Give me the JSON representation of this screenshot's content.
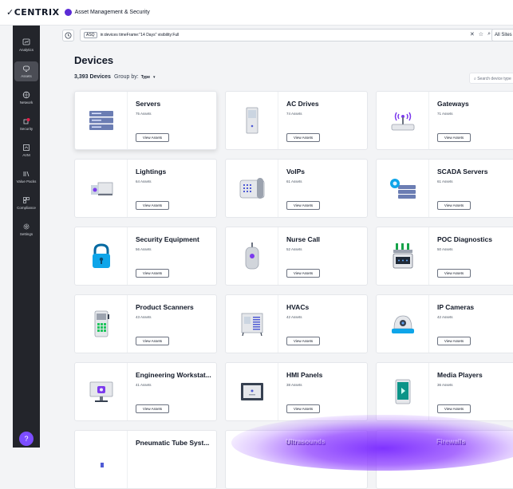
{
  "app": {
    "brand": "CENTRIX",
    "title": "Asset Management & Security"
  },
  "sidebar": {
    "items": [
      {
        "label": "Analytics",
        "icon": "analytics-icon"
      },
      {
        "label": "Assets",
        "icon": "assets-icon",
        "active": true
      },
      {
        "label": "Network",
        "icon": "network-icon"
      },
      {
        "label": "Security",
        "icon": "security-icon"
      },
      {
        "label": "AVM",
        "icon": "avm-icon"
      },
      {
        "label": "Value Packs",
        "icon": "value-packs-icon"
      },
      {
        "label": "Compliance",
        "icon": "compliance-icon"
      },
      {
        "label": "Settings",
        "icon": "settings-icon"
      }
    ],
    "help_icon": "help-icon"
  },
  "query": {
    "badge": "ASQ",
    "text": "in:devices timeFrame:\"14 Days\" visibility:Full",
    "sites": "All Sites"
  },
  "main": {
    "title": "Devices",
    "count": "3,393 Devices",
    "group_by_label": "Group by:",
    "group_by_value": "Type",
    "search_placeholder": "Search device type"
  },
  "cards": [
    {
      "title": "Servers",
      "sub": "75 Assets",
      "btn": "View Assets"
    },
    {
      "title": "AC Drives",
      "sub": "74 Assets",
      "btn": "View Assets"
    },
    {
      "title": "Gateways",
      "sub": "71 Assets",
      "btn": "View Assets"
    },
    {
      "title": "Lightings",
      "sub": "64 Assets",
      "btn": "View Assets"
    },
    {
      "title": "VoIPs",
      "sub": "61 Assets",
      "btn": "View Assets"
    },
    {
      "title": "SCADA Servers",
      "sub": "61 Assets",
      "btn": "View Assets"
    },
    {
      "title": "Security Equipment",
      "sub": "56 Assets",
      "btn": "View Assets"
    },
    {
      "title": "Nurse Call",
      "sub": "52 Assets",
      "btn": "View Assets"
    },
    {
      "title": "POC Diagnostics",
      "sub": "50 Assets",
      "btn": "View Assets"
    },
    {
      "title": "Product Scanners",
      "sub": "43 Assets",
      "btn": "View Assets"
    },
    {
      "title": "HVACs",
      "sub": "42 Assets",
      "btn": "View Assets"
    },
    {
      "title": "IP Cameras",
      "sub": "42 Assets",
      "btn": "View Assets"
    },
    {
      "title": "Engineering Workstat...",
      "sub": "41 Assets",
      "btn": "View Assets"
    },
    {
      "title": "HMI Panels",
      "sub": "38 Assets",
      "btn": "View Assets"
    },
    {
      "title": "Media Players",
      "sub": "36 Assets",
      "btn": "View Assets"
    },
    {
      "title": "Pneumatic Tube Syst..."
    },
    {
      "title": "Ultrasounds"
    },
    {
      "title": "Firewalls"
    }
  ],
  "colors": {
    "sidebar_bg": "#23252b",
    "accent": "#7c4dff",
    "brand_dot": "#5b2bd6"
  }
}
